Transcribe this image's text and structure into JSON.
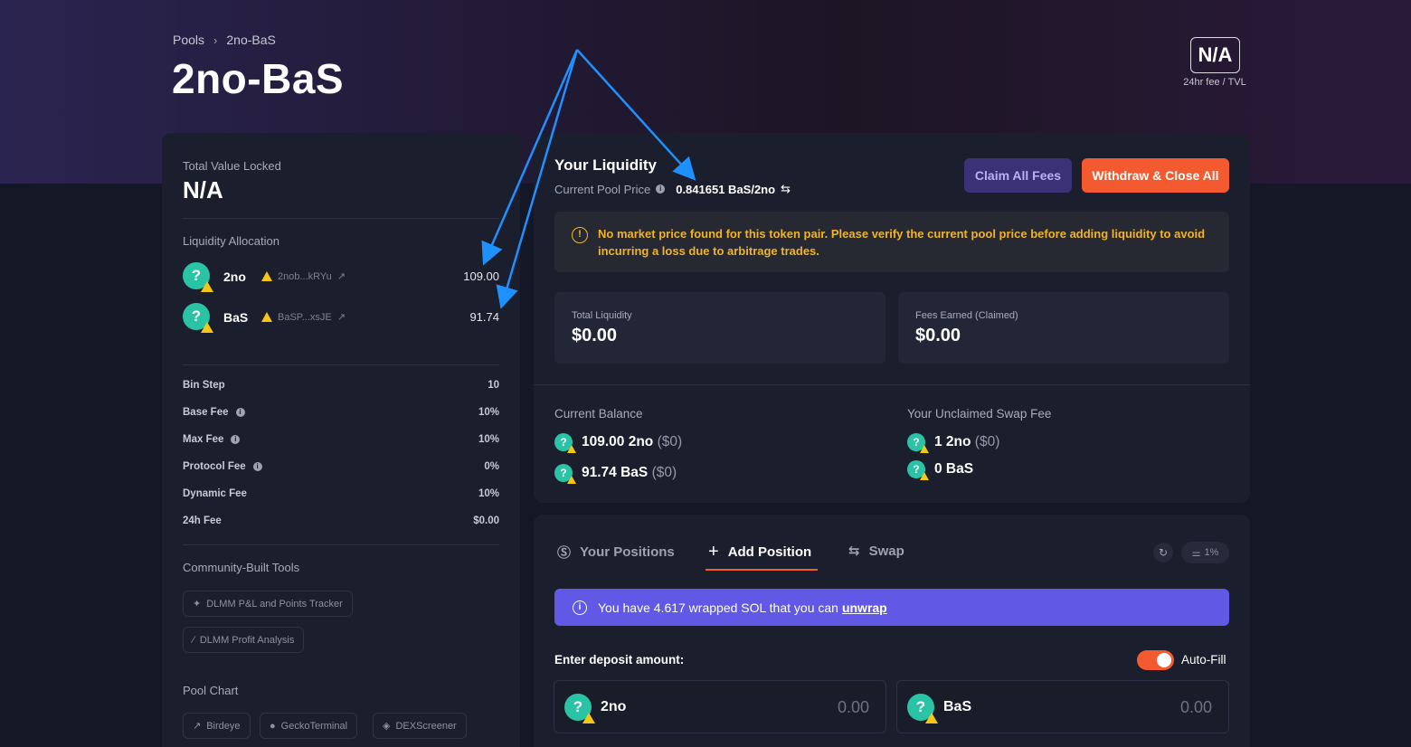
{
  "breadcrumb": {
    "root": "Pools",
    "separator": "›",
    "current": "2no-BaS"
  },
  "page": {
    "title": "2no-BaS"
  },
  "fee_tvl": {
    "value": "N/A",
    "caption": "24hr fee / TVL"
  },
  "tvl": {
    "label": "Total Value Locked",
    "value": "N/A"
  },
  "allocation": {
    "label": "Liquidity Allocation",
    "tokens": [
      {
        "symbol": "2no",
        "address": "2nob...kRYu",
        "amount": "109.00"
      },
      {
        "symbol": "BaS",
        "address": "BaSP...xsJE",
        "amount": "91.74"
      }
    ]
  },
  "stats": [
    {
      "label": "Bin Step",
      "value": "10"
    },
    {
      "label": "Base Fee",
      "value": "10%"
    },
    {
      "label": "Max Fee",
      "value": "10%"
    },
    {
      "label": "Protocol Fee",
      "value": "0%"
    },
    {
      "label": "Dynamic Fee",
      "value": "10%"
    },
    {
      "label": "24h Fee",
      "value": "$0.00"
    }
  ],
  "tools": {
    "label": "Community-Built Tools",
    "items": [
      "DLMM P&L and Points Tracker",
      "DLMM Profit Analysis"
    ]
  },
  "pool_chart": {
    "label": "Pool Chart",
    "items": [
      "Birdeye",
      "GeckoTerminal",
      "DEXScreener"
    ]
  },
  "liquidity": {
    "title": "Your Liquidity",
    "price_label": "Current Pool Price",
    "price_value": "0.841651 BaS/2no",
    "claim_label": "Claim All Fees",
    "withdraw_label": "Withdraw & Close All",
    "warning": "No market price found for this token pair. Please verify the current pool price before adding liquidity to avoid incurring a loss due to arbitrage trades.",
    "total_label": "Total Liquidity",
    "total_value": "$0.00",
    "fees_label": "Fees Earned (Claimed)",
    "fees_value": "$0.00"
  },
  "balance": {
    "label": "Current Balance",
    "rows": [
      {
        "amount": "109.00 2no",
        "usd": "($0)"
      },
      {
        "amount": "91.74 BaS",
        "usd": "($0)"
      }
    ]
  },
  "unclaimed": {
    "label": "Your Unclaimed Swap Fee",
    "rows": [
      {
        "amount": "1 2no",
        "usd": "($0)"
      },
      {
        "amount": "0 BaS",
        "usd": ""
      }
    ]
  },
  "tabs": {
    "positions": "Your Positions",
    "add": "Add Position",
    "swap": "Swap"
  },
  "slippage": "1%",
  "sol_banner": {
    "text": "You have 4.617 wrapped SOL that you can",
    "link": "unwrap"
  },
  "deposit": {
    "label": "Enter deposit amount:",
    "autofill": "Auto-Fill",
    "inputs": [
      {
        "symbol": "2no",
        "value": "0.00"
      },
      {
        "symbol": "BaS",
        "value": "0.00"
      }
    ]
  },
  "colors": {
    "accent": "#f45a2f",
    "purple": "#6159e6",
    "warning": "#f0b429",
    "token": "#2bc3a6",
    "annotation": "#1e90ff"
  }
}
